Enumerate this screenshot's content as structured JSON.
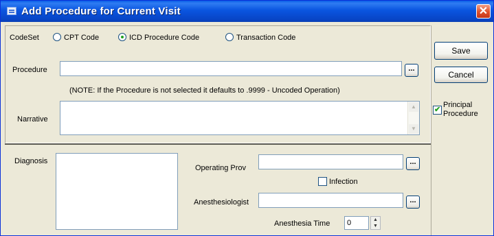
{
  "window": {
    "title": "Add Procedure for Current Visit",
    "close_glyph": "✕"
  },
  "codeset": {
    "label": "CodeSet",
    "options": [
      {
        "label": "CPT Code",
        "selected": false
      },
      {
        "label": "ICD Procedure Code",
        "selected": true
      },
      {
        "label": "Transaction Code",
        "selected": false
      }
    ]
  },
  "procedure": {
    "label": "Procedure",
    "value": "",
    "browse_label": "...",
    "note": "(NOTE: If the Procedure is not selected it defaults to .9999 - Uncoded Operation)"
  },
  "narrative": {
    "label": "Narrative",
    "value": ""
  },
  "diagnosis": {
    "label": "Diagnosis",
    "items": []
  },
  "operating_prov": {
    "label": "Operating Prov",
    "value": "",
    "browse_label": "..."
  },
  "infection": {
    "label": "Infection",
    "checked": false
  },
  "anesthesiologist": {
    "label": "Anesthesiologist",
    "value": "",
    "browse_label": "..."
  },
  "anesthesia_time": {
    "label": "Anesthesia Time",
    "value": "0"
  },
  "actions": {
    "save_label": "Save",
    "cancel_label": "Cancel"
  },
  "principal_procedure": {
    "label_line1": "Principal",
    "label_line2": "Procedure",
    "checked": true
  },
  "icons": {
    "window_icon": "window-app-icon",
    "close": "close-icon",
    "scroll_up": "scroll-up-arrow-icon",
    "scroll_down": "scroll-down-arrow-icon",
    "spin_up": "spin-up-arrow-icon",
    "spin_down": "spin-down-arrow-icon"
  },
  "colors": {
    "titlebar": "#0a55e0",
    "dialog_bg": "#ece9d8",
    "close_button": "#e0502a",
    "radio_dot": "#21a121"
  }
}
